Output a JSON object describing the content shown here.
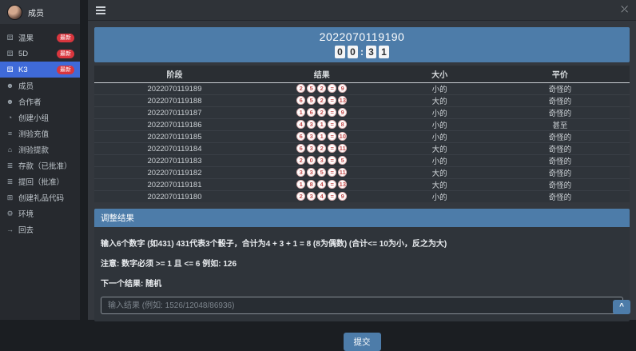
{
  "sidebar": {
    "user": {
      "name": "成员"
    },
    "badge_label": "最新",
    "items": [
      {
        "key": "wingo",
        "label": "温果",
        "icon": "dice-icon",
        "badge": true,
        "active": false
      },
      {
        "key": "5d",
        "label": "5D",
        "icon": "dice-icon",
        "badge": true,
        "active": false
      },
      {
        "key": "k3",
        "label": "K3",
        "icon": "dice-icon",
        "badge": true,
        "active": true
      },
      {
        "key": "members",
        "label": "成员",
        "icon": "user-icon",
        "badge": false,
        "active": false
      },
      {
        "key": "partners",
        "label": "合作者",
        "icon": "users-icon",
        "badge": false,
        "active": false
      },
      {
        "key": "create-group",
        "label": "创建小组",
        "icon": "pie-icon",
        "badge": false,
        "active": false
      },
      {
        "key": "review-recharge",
        "label": "测验充值",
        "icon": "bars-icon",
        "badge": false,
        "active": false
      },
      {
        "key": "review-withdraw",
        "label": "测验提款",
        "icon": "bank-icon",
        "badge": false,
        "active": false
      },
      {
        "key": "deposits-approved",
        "label": "存款（已批准）",
        "icon": "list-icon",
        "badge": false,
        "active": false
      },
      {
        "key": "withdraw-approved",
        "label": "提回（批准）",
        "icon": "list-icon",
        "badge": false,
        "active": false
      },
      {
        "key": "gift-code",
        "label": "创建礼品代码",
        "icon": "gift-icon",
        "badge": false,
        "active": false
      },
      {
        "key": "environment",
        "label": "环境",
        "icon": "gear-icon",
        "badge": false,
        "active": false
      },
      {
        "key": "logout",
        "label": "回去",
        "icon": "logout-icon",
        "badge": false,
        "active": false
      }
    ]
  },
  "banner": {
    "period": "2022070119190",
    "countdown": [
      "0",
      "0",
      ":",
      "3",
      "1"
    ]
  },
  "table": {
    "headers": [
      "阶段",
      "结果",
      "大小",
      "平价"
    ],
    "rows": [
      {
        "period": "2022070119189",
        "digits": [
          "2",
          "5",
          "2"
        ],
        "sum": "9",
        "size": "小的",
        "parity": "奇怪的"
      },
      {
        "period": "2022070119188",
        "digits": [
          "6",
          "5",
          "2"
        ],
        "sum": "13",
        "size": "大的",
        "parity": "奇怪的"
      },
      {
        "period": "2022070119187",
        "digits": [
          "1",
          "6",
          "2"
        ],
        "sum": "9",
        "size": "小的",
        "parity": "奇怪的"
      },
      {
        "period": "2022070119186",
        "digits": [
          "4",
          "3",
          "1"
        ],
        "sum": "8",
        "size": "小的",
        "parity": "甚至"
      },
      {
        "period": "2022070119185",
        "digits": [
          "6",
          "3",
          "1"
        ],
        "sum": "10",
        "size": "小的",
        "parity": "奇怪的"
      },
      {
        "period": "2022070119184",
        "digits": [
          "6",
          "3",
          "2"
        ],
        "sum": "11",
        "size": "大的",
        "parity": "奇怪的"
      },
      {
        "period": "2022070119183",
        "digits": [
          "2",
          "0",
          "3"
        ],
        "sum": "5",
        "size": "小的",
        "parity": "奇怪的"
      },
      {
        "period": "2022070119182",
        "digits": [
          "3",
          "3",
          "5"
        ],
        "sum": "11",
        "size": "大的",
        "parity": "奇怪的"
      },
      {
        "period": "2022070119181",
        "digits": [
          "1",
          "8",
          "4"
        ],
        "sum": "13",
        "size": "大的",
        "parity": "奇怪的"
      },
      {
        "period": "2022070119180",
        "digits": [
          "2",
          "3",
          "4"
        ],
        "sum": "9",
        "size": "小的",
        "parity": "奇怪的"
      }
    ]
  },
  "panel": {
    "title": "调整结果",
    "line1": "输入6个数字 (如431)  431代表3个骰子，合计为4 + 3 + 1 = 8 (8为偶数)  (合计<= 10为小，反之为大)",
    "line2": "注意: 数字必须 >= 1 且 <= 6 例如: 126",
    "line3": "下一个结果: 随机",
    "input_placeholder": "输入结果 (例如: 1526/12048/86936)"
  },
  "submit_label": "提交",
  "scroll_top_label": "^"
}
